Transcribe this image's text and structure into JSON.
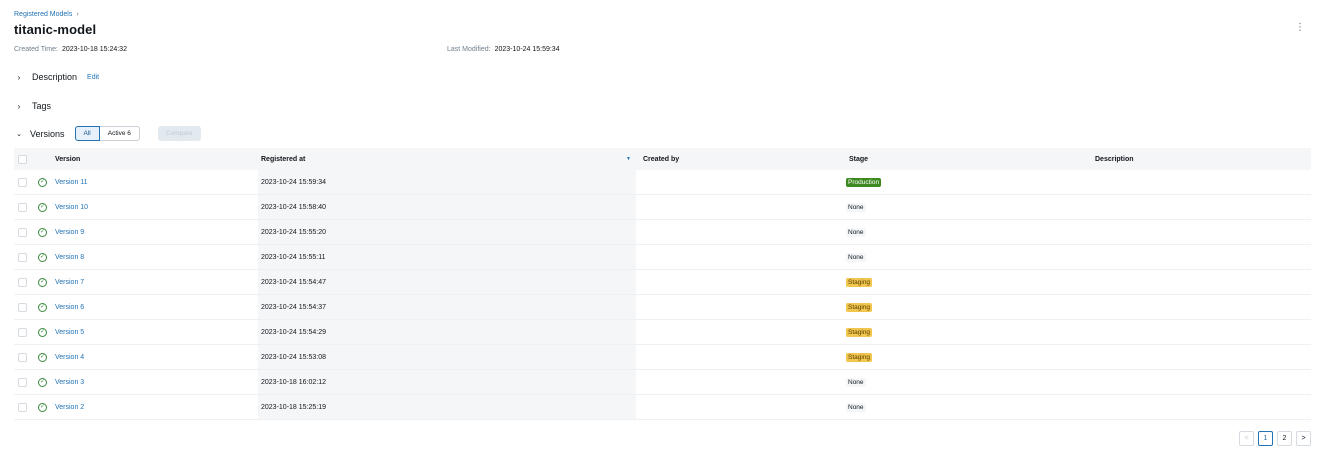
{
  "breadcrumb": {
    "parent": "Registered Models",
    "sep": "›"
  },
  "title": "titanic-model",
  "menu_icon": "⋮",
  "meta": {
    "created_label": "Created Time:",
    "created_value": "2023-10-18 15:24:32",
    "modified_label": "Last Modified:",
    "modified_value": "2023-10-24 15:59:34"
  },
  "sections": {
    "description": {
      "label": "Description",
      "edit": "Edit"
    },
    "tags": {
      "label": "Tags"
    },
    "versions": {
      "label": "Versions",
      "filter_all": "All",
      "filter_active": "Active 6",
      "compare": "Compare"
    }
  },
  "table": {
    "headers": {
      "version": "Version",
      "registered_at": "Registered at",
      "created_by": "Created by",
      "stage": "Stage",
      "description": "Description"
    },
    "rows": [
      {
        "version": "Version 11",
        "registered_at": "2023-10-24 15:59:34",
        "created_by": "",
        "stage": "Production",
        "description": ""
      },
      {
        "version": "Version 10",
        "registered_at": "2023-10-24 15:58:40",
        "created_by": "",
        "stage": "None",
        "description": ""
      },
      {
        "version": "Version 9",
        "registered_at": "2023-10-24 15:55:20",
        "created_by": "",
        "stage": "None",
        "description": ""
      },
      {
        "version": "Version 8",
        "registered_at": "2023-10-24 15:55:11",
        "created_by": "",
        "stage": "None",
        "description": ""
      },
      {
        "version": "Version 7",
        "registered_at": "2023-10-24 15:54:47",
        "created_by": "",
        "stage": "Staging",
        "description": ""
      },
      {
        "version": "Version 6",
        "registered_at": "2023-10-24 15:54:37",
        "created_by": "",
        "stage": "Staging",
        "description": ""
      },
      {
        "version": "Version 5",
        "registered_at": "2023-10-24 15:54:29",
        "created_by": "",
        "stage": "Staging",
        "description": ""
      },
      {
        "version": "Version 4",
        "registered_at": "2023-10-24 15:53:08",
        "created_by": "",
        "stage": "Staging",
        "description": ""
      },
      {
        "version": "Version 3",
        "registered_at": "2023-10-18 16:02:12",
        "created_by": "",
        "stage": "None",
        "description": ""
      },
      {
        "version": "Version 2",
        "registered_at": "2023-10-18 15:25:19",
        "created_by": "",
        "stage": "None",
        "description": ""
      }
    ]
  },
  "pagination": {
    "prev": "<",
    "pages": [
      "1",
      "2"
    ],
    "current": "1",
    "next": ">"
  },
  "colors": {
    "link": "#2272b4",
    "production": "#3c8a1f",
    "staging": "#f0c64e",
    "ok": "#3a8a3d"
  }
}
